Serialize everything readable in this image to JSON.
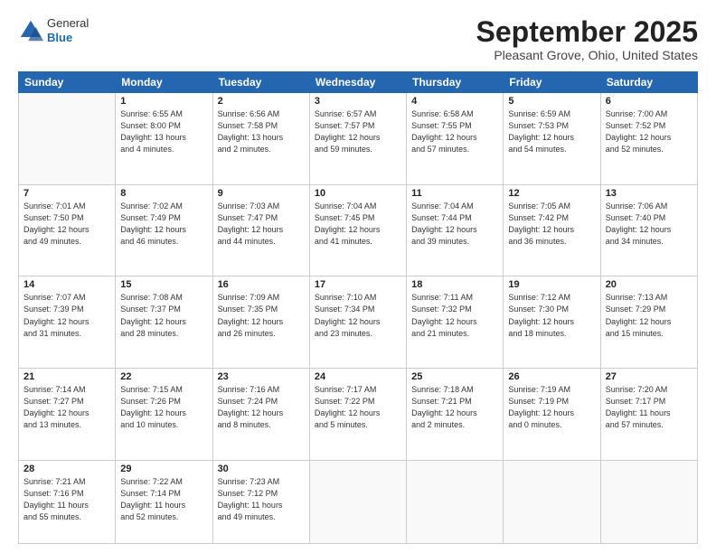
{
  "header": {
    "logo": {
      "general": "General",
      "blue": "Blue"
    },
    "title": "September 2025",
    "location": "Pleasant Grove, Ohio, United States"
  },
  "weekdays": [
    "Sunday",
    "Monday",
    "Tuesday",
    "Wednesday",
    "Thursday",
    "Friday",
    "Saturday"
  ],
  "weeks": [
    [
      {
        "day": "",
        "info": ""
      },
      {
        "day": "1",
        "info": "Sunrise: 6:55 AM\nSunset: 8:00 PM\nDaylight: 13 hours\nand 4 minutes."
      },
      {
        "day": "2",
        "info": "Sunrise: 6:56 AM\nSunset: 7:58 PM\nDaylight: 13 hours\nand 2 minutes."
      },
      {
        "day": "3",
        "info": "Sunrise: 6:57 AM\nSunset: 7:57 PM\nDaylight: 12 hours\nand 59 minutes."
      },
      {
        "day": "4",
        "info": "Sunrise: 6:58 AM\nSunset: 7:55 PM\nDaylight: 12 hours\nand 57 minutes."
      },
      {
        "day": "5",
        "info": "Sunrise: 6:59 AM\nSunset: 7:53 PM\nDaylight: 12 hours\nand 54 minutes."
      },
      {
        "day": "6",
        "info": "Sunrise: 7:00 AM\nSunset: 7:52 PM\nDaylight: 12 hours\nand 52 minutes."
      }
    ],
    [
      {
        "day": "7",
        "info": "Sunrise: 7:01 AM\nSunset: 7:50 PM\nDaylight: 12 hours\nand 49 minutes."
      },
      {
        "day": "8",
        "info": "Sunrise: 7:02 AM\nSunset: 7:49 PM\nDaylight: 12 hours\nand 46 minutes."
      },
      {
        "day": "9",
        "info": "Sunrise: 7:03 AM\nSunset: 7:47 PM\nDaylight: 12 hours\nand 44 minutes."
      },
      {
        "day": "10",
        "info": "Sunrise: 7:04 AM\nSunset: 7:45 PM\nDaylight: 12 hours\nand 41 minutes."
      },
      {
        "day": "11",
        "info": "Sunrise: 7:04 AM\nSunset: 7:44 PM\nDaylight: 12 hours\nand 39 minutes."
      },
      {
        "day": "12",
        "info": "Sunrise: 7:05 AM\nSunset: 7:42 PM\nDaylight: 12 hours\nand 36 minutes."
      },
      {
        "day": "13",
        "info": "Sunrise: 7:06 AM\nSunset: 7:40 PM\nDaylight: 12 hours\nand 34 minutes."
      }
    ],
    [
      {
        "day": "14",
        "info": "Sunrise: 7:07 AM\nSunset: 7:39 PM\nDaylight: 12 hours\nand 31 minutes."
      },
      {
        "day": "15",
        "info": "Sunrise: 7:08 AM\nSunset: 7:37 PM\nDaylight: 12 hours\nand 28 minutes."
      },
      {
        "day": "16",
        "info": "Sunrise: 7:09 AM\nSunset: 7:35 PM\nDaylight: 12 hours\nand 26 minutes."
      },
      {
        "day": "17",
        "info": "Sunrise: 7:10 AM\nSunset: 7:34 PM\nDaylight: 12 hours\nand 23 minutes."
      },
      {
        "day": "18",
        "info": "Sunrise: 7:11 AM\nSunset: 7:32 PM\nDaylight: 12 hours\nand 21 minutes."
      },
      {
        "day": "19",
        "info": "Sunrise: 7:12 AM\nSunset: 7:30 PM\nDaylight: 12 hours\nand 18 minutes."
      },
      {
        "day": "20",
        "info": "Sunrise: 7:13 AM\nSunset: 7:29 PM\nDaylight: 12 hours\nand 15 minutes."
      }
    ],
    [
      {
        "day": "21",
        "info": "Sunrise: 7:14 AM\nSunset: 7:27 PM\nDaylight: 12 hours\nand 13 minutes."
      },
      {
        "day": "22",
        "info": "Sunrise: 7:15 AM\nSunset: 7:26 PM\nDaylight: 12 hours\nand 10 minutes."
      },
      {
        "day": "23",
        "info": "Sunrise: 7:16 AM\nSunset: 7:24 PM\nDaylight: 12 hours\nand 8 minutes."
      },
      {
        "day": "24",
        "info": "Sunrise: 7:17 AM\nSunset: 7:22 PM\nDaylight: 12 hours\nand 5 minutes."
      },
      {
        "day": "25",
        "info": "Sunrise: 7:18 AM\nSunset: 7:21 PM\nDaylight: 12 hours\nand 2 minutes."
      },
      {
        "day": "26",
        "info": "Sunrise: 7:19 AM\nSunset: 7:19 PM\nDaylight: 12 hours\nand 0 minutes."
      },
      {
        "day": "27",
        "info": "Sunrise: 7:20 AM\nSunset: 7:17 PM\nDaylight: 11 hours\nand 57 minutes."
      }
    ],
    [
      {
        "day": "28",
        "info": "Sunrise: 7:21 AM\nSunset: 7:16 PM\nDaylight: 11 hours\nand 55 minutes."
      },
      {
        "day": "29",
        "info": "Sunrise: 7:22 AM\nSunset: 7:14 PM\nDaylight: 11 hours\nand 52 minutes."
      },
      {
        "day": "30",
        "info": "Sunrise: 7:23 AM\nSunset: 7:12 PM\nDaylight: 11 hours\nand 49 minutes."
      },
      {
        "day": "",
        "info": ""
      },
      {
        "day": "",
        "info": ""
      },
      {
        "day": "",
        "info": ""
      },
      {
        "day": "",
        "info": ""
      }
    ]
  ]
}
